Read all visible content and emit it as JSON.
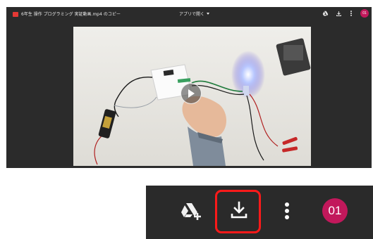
{
  "viewer": {
    "file_title": "6年生 操作 プログラミング 実証動画.mp4 のコピー",
    "open_with_label": "アプリで開く",
    "avatar_label": "01"
  },
  "zoom": {
    "avatar_label": "01"
  },
  "colors": {
    "toolbar_bg": "#2a2a2a",
    "avatar_bg": "#c2185b",
    "highlight": "#ff1a1a",
    "file_icon": "#e53935"
  },
  "icons": {
    "file": "video-file-icon",
    "drive": "add-to-drive-icon",
    "download": "download-icon",
    "more": "more-vert-icon",
    "play": "play-icon"
  }
}
